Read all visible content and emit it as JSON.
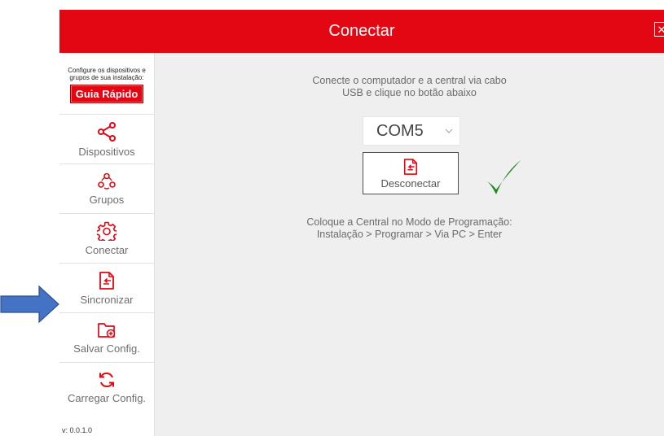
{
  "window": {
    "title": "Conectar",
    "close_glyph": "✕",
    "accent_color": "#e30613"
  },
  "sidebar": {
    "hint": "Configure os dispositivos e grupos de sua instalação:",
    "guide_button": "Guia Rápido",
    "items": [
      {
        "label": "Dispositivos",
        "icon": "share-icon"
      },
      {
        "label": "Grupos",
        "icon": "group-icon"
      },
      {
        "label": "Conectar",
        "icon": "gear-icon"
      },
      {
        "label": "Sincronizar",
        "icon": "sync-icon"
      },
      {
        "label": "Salvar Config.",
        "icon": "folder-add-icon"
      },
      {
        "label": "Carregar Config.",
        "icon": "refresh-icon"
      }
    ],
    "version": "v: 0.0.1.0"
  },
  "main": {
    "instruction_1": "Conecte o computador e a central via cabo USB e clique no botão abaixo",
    "port_value": "COM5",
    "connect_button": "Desconectar",
    "status_icon": "checkmark-icon",
    "instruction_2_line1": "Coloque a Central no Modo de Programação:",
    "instruction_2_line2": "Instalação > Programar > Via PC > Enter"
  },
  "annotation": {
    "arrow_color": "#4472c4"
  }
}
